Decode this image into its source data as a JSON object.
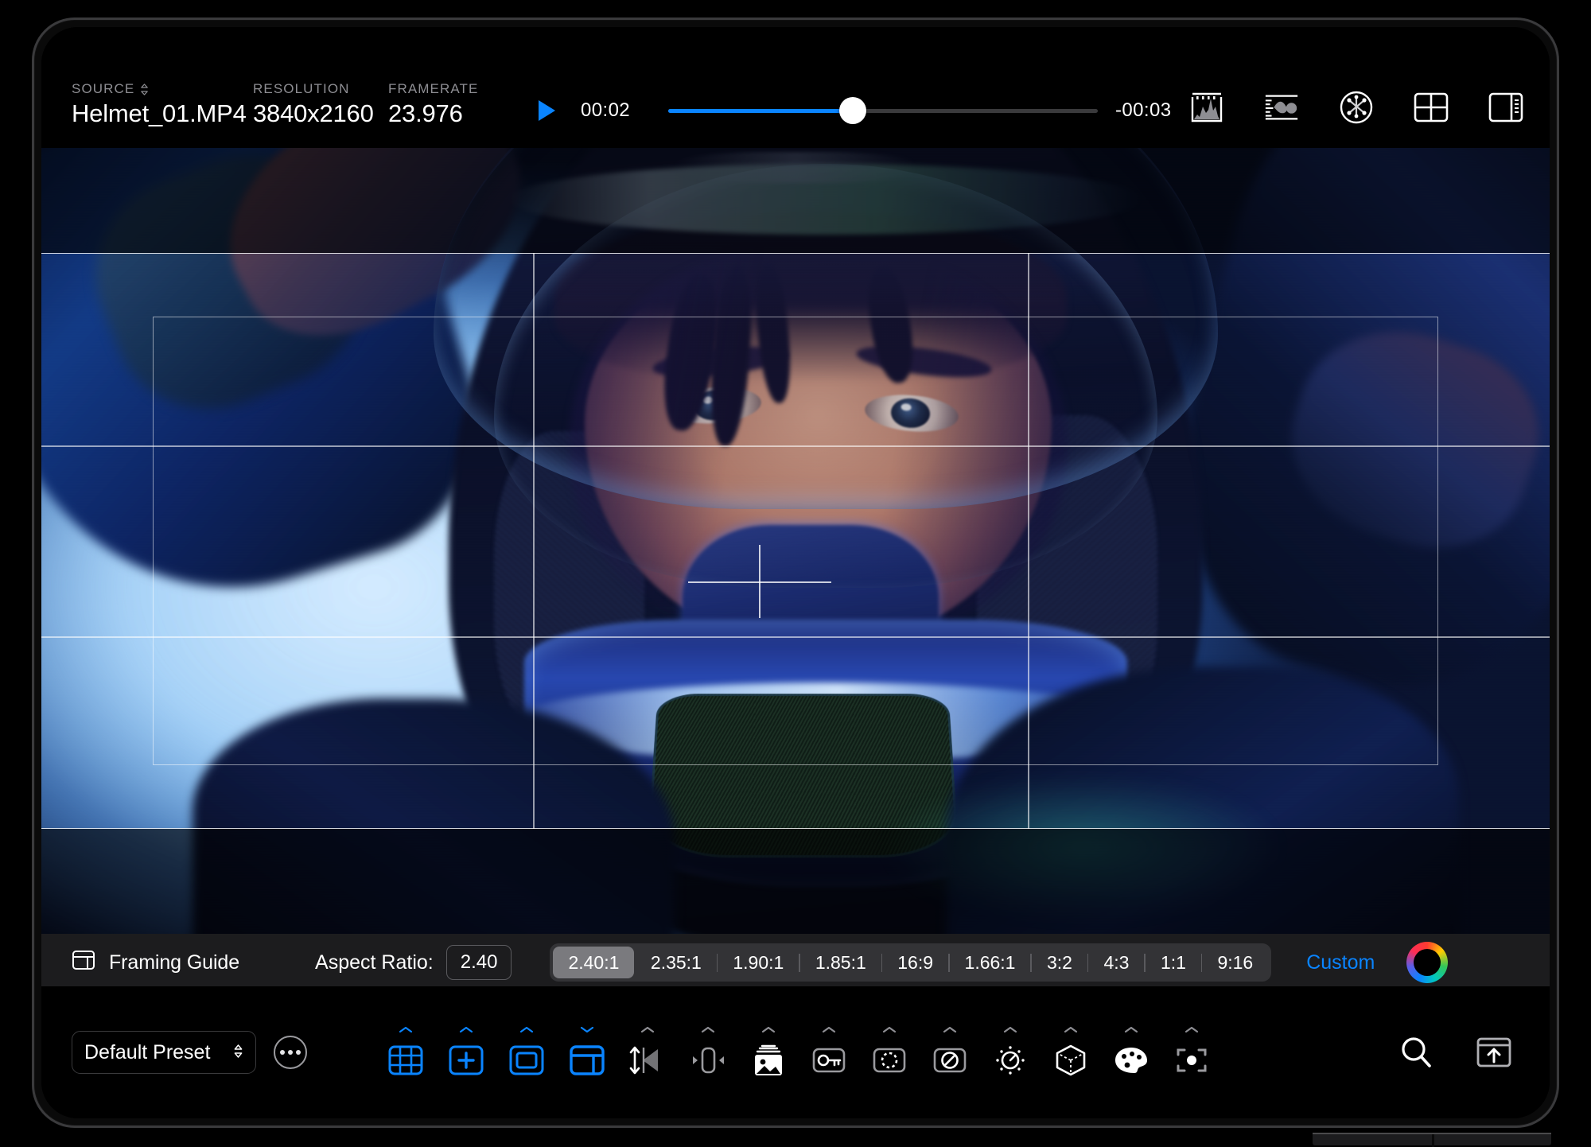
{
  "header": {
    "source_label": "SOURCE",
    "source_value": "Helmet_01.MP4",
    "resolution_label": "RESOLUTION",
    "resolution_value": "3840x2160",
    "framerate_label": "FRAMERATE",
    "framerate_value": "23.976",
    "source_sort_icon": "chevron-up-down-icon"
  },
  "playback": {
    "play_icon": "play-icon",
    "current_time": "00:02",
    "remaining_time": "-00:03",
    "progress_percent": 43,
    "accent_color": "#0a84ff"
  },
  "scopes": [
    {
      "name": "histogram-icon",
      "label": "Histogram"
    },
    {
      "name": "waveform-icon",
      "label": "Waveform"
    },
    {
      "name": "vectorscope-icon",
      "label": "Vectorscope"
    },
    {
      "name": "quad-view-icon",
      "label": "Quad View"
    },
    {
      "name": "inspector-panel-icon",
      "label": "Inspector"
    }
  ],
  "viewer": {
    "overlay_type": "rule-of-thirds",
    "crosshair": true,
    "safe_area": true
  },
  "framing_guide": {
    "icon": "framing-guide-icon",
    "title": "Framing Guide",
    "aspect_ratio_label": "Aspect Ratio:",
    "aspect_ratio_value": "2.40",
    "presets": [
      "2.40:1",
      "2.35:1",
      "1.90:1",
      "1.85:1",
      "16:9",
      "1.66:1",
      "3:2",
      "4:3",
      "1:1",
      "9:16"
    ],
    "selected_preset": "2.40:1",
    "custom_label": "Custom",
    "custom_color": "#0a84ff",
    "color_wheel_icon": "color-wheel-icon"
  },
  "toolbar": {
    "preset_value": "Default Preset",
    "preset_chevron_icon": "chevron-up-down-icon",
    "more_icon": "ellipsis-icon",
    "tools": [
      {
        "name": "grid-overlay-icon",
        "label": "Grid Overlay",
        "active": true
      },
      {
        "name": "crosshair-overlay-icon",
        "label": "Crosshair",
        "active": true
      },
      {
        "name": "safe-area-icon",
        "label": "Safe Area",
        "active": true
      },
      {
        "name": "framing-guide-tool-icon",
        "label": "Framing Guide",
        "active": true,
        "selected": true
      },
      {
        "name": "flip-horizontal-icon",
        "label": "Flip Horizontal",
        "active": false
      },
      {
        "name": "anamorphic-desqueeze-icon",
        "label": "Desqueeze",
        "active": false
      },
      {
        "name": "image-overlay-icon",
        "label": "Image Overlay",
        "active": false
      },
      {
        "name": "license-key-icon",
        "label": "License",
        "active": false
      },
      {
        "name": "focus-assist-icon",
        "label": "Focus Assist",
        "active": false
      },
      {
        "name": "false-color-icon",
        "label": "False Color",
        "active": false
      },
      {
        "name": "exposure-icon",
        "label": "Exposure",
        "active": false
      },
      {
        "name": "lut-cube-icon",
        "label": "3D LUT",
        "active": false
      },
      {
        "name": "color-palette-icon",
        "label": "Color",
        "active": false
      },
      {
        "name": "frame-capture-icon",
        "label": "Frame Grab",
        "active": false
      }
    ],
    "right_tools": [
      {
        "name": "search-icon",
        "label": "Search"
      },
      {
        "name": "export-upload-icon",
        "label": "Export"
      }
    ]
  }
}
